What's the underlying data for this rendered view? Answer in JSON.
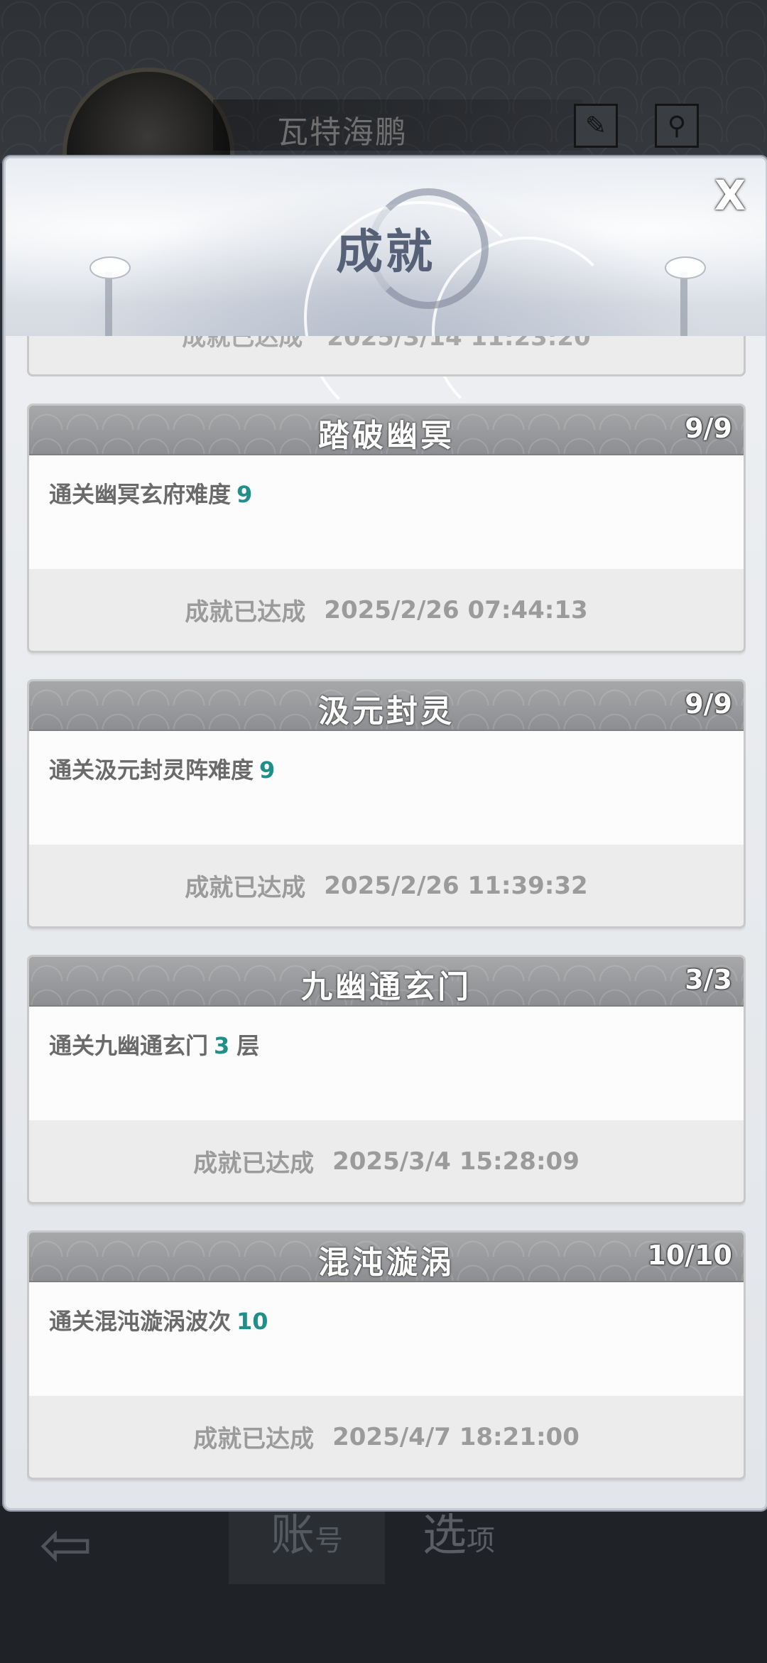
{
  "background": {
    "player_name": "瓦特海鹏",
    "tabs": [
      {
        "main": "账",
        "sub": "号"
      },
      {
        "main": "选",
        "sub": "项"
      }
    ]
  },
  "modal": {
    "title": "成就",
    "close_label": "X",
    "partial_text": "成就已达成　2025/3/14 11:23:20",
    "cards": [
      {
        "title": "踏破幽冥",
        "progress": "9/9",
        "desc": "通关幽冥玄府难度",
        "value": "9",
        "unit": "",
        "status": "成就已达成",
        "date": "2025/2/26 07:44:13"
      },
      {
        "title": "汲元封灵",
        "progress": "9/9",
        "desc": "通关汲元封灵阵难度",
        "value": "9",
        "unit": "",
        "status": "成就已达成",
        "date": "2025/2/26 11:39:32"
      },
      {
        "title": "九幽通玄门",
        "progress": "3/3",
        "desc": "通关九幽通玄门",
        "value": "3",
        "unit": "层",
        "status": "成就已达成",
        "date": "2025/3/4 15:28:09"
      },
      {
        "title": "混沌漩涡",
        "progress": "10/10",
        "desc": "通关混沌漩涡波次",
        "value": "10",
        "unit": "",
        "status": "成就已达成",
        "date": "2025/4/7 18:21:00"
      }
    ]
  },
  "colors": {
    "accent_value": "#1f8f8a",
    "title_text": "#566177"
  }
}
